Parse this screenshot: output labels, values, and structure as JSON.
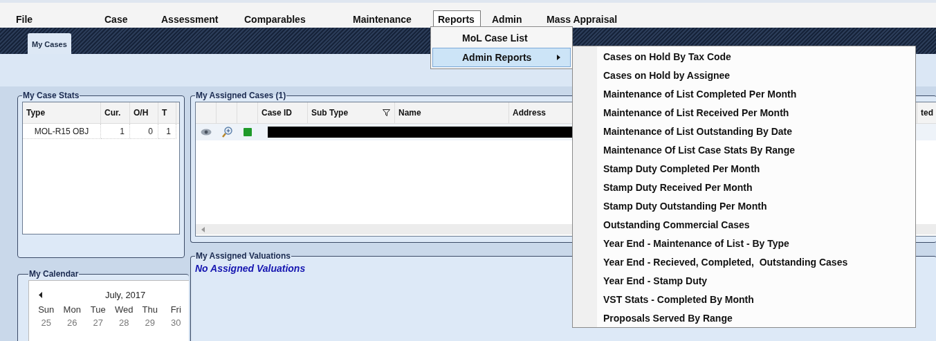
{
  "menu_bar": [
    {
      "label": "File",
      "selected": false
    },
    {
      "label": "Case",
      "selected": false
    },
    {
      "label": "Assessment",
      "selected": false
    },
    {
      "label": "Comparables",
      "selected": false
    },
    {
      "label": "Maintenance",
      "selected": false
    },
    {
      "label": "Reports",
      "selected": true
    },
    {
      "label": "Admin",
      "selected": false
    },
    {
      "label": "Mass Appraisal",
      "selected": false
    }
  ],
  "reports_menu": [
    {
      "label": "MoL Case List",
      "selected": false,
      "submenu": false
    },
    {
      "label": "Admin Reports",
      "selected": true,
      "submenu": true
    }
  ],
  "admin_reports_submenu": [
    "Cases on Hold By Tax Code",
    "Cases on Hold by Assignee",
    "Maintenance of List Completed Per Month",
    "Maintenance of List Received Per Month",
    "Maintenance of List Outstanding By Date",
    "Maintenance Of List Case Stats By Range",
    "Stamp Duty Completed Per Month",
    "Stamp Duty Received Per Month",
    "Stamp Duty Outstanding Per Month",
    "Outstanding Commercial Cases",
    "Year End - Maintenance of List - By Type",
    "Year End - Recieved, Completed,  Outstanding Cases",
    "Year End - Stamp Duty",
    "VST Stats - Completed By Month",
    "Proposals Served By Range"
  ],
  "tabs": [
    {
      "label": "My Cases",
      "selected": true
    }
  ],
  "case_stats": {
    "title": "My Case Stats",
    "columns": [
      "Type",
      "Cur.",
      "O/H",
      "T"
    ],
    "rows": [
      [
        "MOL-R15 OBJ",
        "1",
        "0",
        "1"
      ]
    ]
  },
  "calendar": {
    "title": "My Calendar",
    "month": "July, 2017",
    "weekdays": [
      "Sun",
      "Mon",
      "Tue",
      "Wed",
      "Thu",
      "Fri"
    ],
    "days": [
      "25",
      "26",
      "27",
      "28",
      "29",
      "30"
    ]
  },
  "assigned_cases": {
    "title": "My Assigned Cases (1)",
    "columns": [
      {
        "label": "Case ID",
        "filter": false
      },
      {
        "label": "Sub Type",
        "filter": true
      },
      {
        "label": "Name",
        "filter": false
      },
      {
        "label": "Address"
      },
      {
        "label": "ted"
      }
    ],
    "rows": [
      {
        "redacted": true
      }
    ]
  },
  "assigned_valuations": {
    "title": "My Assigned Valuations",
    "message": "No Assigned Valuations"
  }
}
